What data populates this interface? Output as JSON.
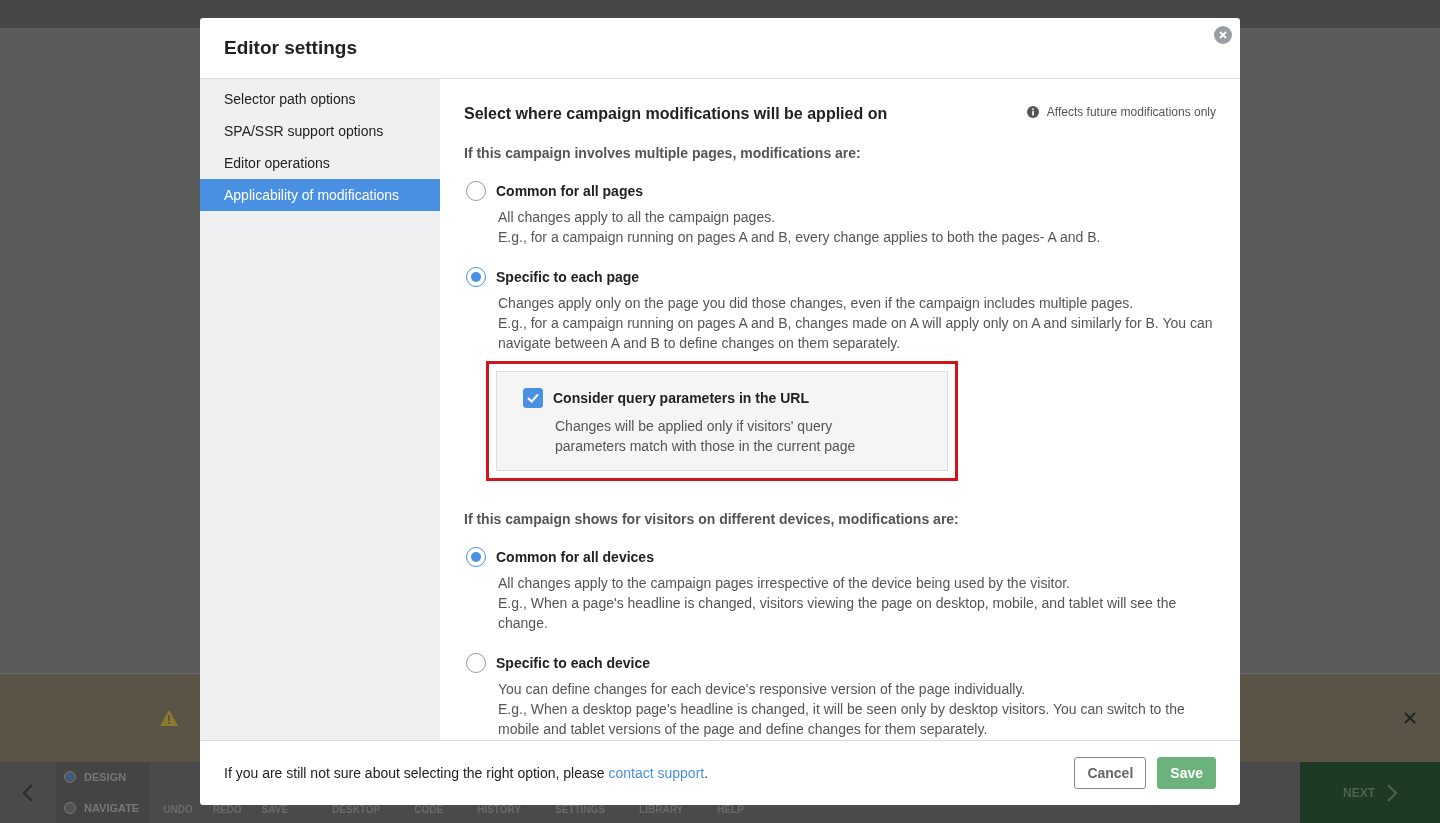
{
  "background": {
    "toolbar": {
      "modes": [
        {
          "label": "DESIGN",
          "selected": true
        },
        {
          "label": "NAVIGATE",
          "selected": false
        }
      ],
      "actions": [
        "UNDO",
        "REDO",
        "SAVE"
      ],
      "tools": [
        "DESKTOP",
        "CODE",
        "HISTORY",
        "SETTINGS",
        "LIBRARY",
        "HELP"
      ],
      "next": "NEXT"
    }
  },
  "modal": {
    "title": "Editor settings",
    "sidebar": {
      "items": [
        {
          "label": "Selector path options",
          "selected": false
        },
        {
          "label": "SPA/SSR support options",
          "selected": false
        },
        {
          "label": "Editor operations",
          "selected": false
        },
        {
          "label": "Applicability of modifications",
          "selected": true
        }
      ]
    },
    "content": {
      "title": "Select where campaign modifications will be applied on",
      "note": "Affects future modifications only",
      "sections": [
        {
          "heading": "If this campaign involves multiple pages, modifications are:",
          "options": [
            {
              "label": "Common for all pages",
              "selected": false,
              "description": [
                "All changes apply to all the campaign pages.",
                "E.g., for a campaign running on pages A and B, every change applies to both the pages- A and B."
              ]
            },
            {
              "label": "Specific to each page",
              "selected": true,
              "description": [
                "Changes apply only on the page you did those changes, even if the campaign includes multiple pages.",
                "E.g., for a campaign running on pages A and B, changes made on A will apply only on A and similarly for B. You can navigate between A and B to define changes on them separately."
              ],
              "sub_option": {
                "label": "Consider query parameters in the URL",
                "checked": true,
                "highlighted": true,
                "description": "Changes will be applied only if visitors' query parameters match with those in the current page"
              }
            }
          ]
        },
        {
          "heading": "If this campaign shows for visitors on different devices, modifications are:",
          "options": [
            {
              "label": "Common for all devices",
              "selected": true,
              "description": [
                "All changes apply to the campaign pages irrespective of the device being used by the visitor.",
                "E.g., When a page's headline is changed, visitors viewing the page on desktop, mobile, and tablet will see the change."
              ]
            },
            {
              "label": "Specific to each device",
              "selected": false,
              "description": [
                "You can define changes for each device's responsive version of the page individually.",
                "E.g., When a desktop page's headline is changed, it will be seen only by desktop visitors. You can switch to the mobile and tablet versions of the page and define changes for them separately."
              ]
            }
          ]
        }
      ]
    },
    "footer": {
      "text_before": "If you are still not sure about selecting the right option, please",
      "link": "contact support",
      "text_after": ".",
      "buttons": [
        {
          "label": "Cancel",
          "kind": "secondary"
        },
        {
          "label": "Save",
          "kind": "primary"
        }
      ]
    }
  }
}
